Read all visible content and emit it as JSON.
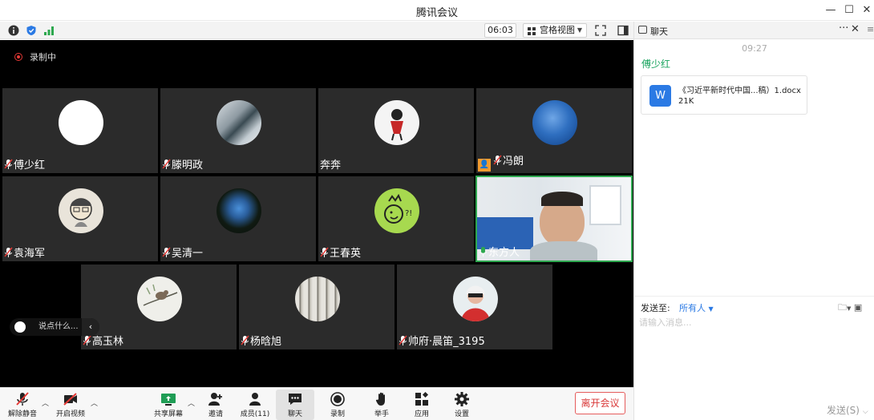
{
  "window": {
    "title": "腾讯会议"
  },
  "topbar": {
    "time": "06:03",
    "view_label": "宫格视图"
  },
  "recording": {
    "label": "录制中"
  },
  "participants": [
    {
      "name": "傅少红",
      "muted": true
    },
    {
      "name": "滕明政",
      "muted": true
    },
    {
      "name": "奔奔",
      "muted": false
    },
    {
      "name": "冯朗",
      "muted": true
    },
    {
      "name": "袁海军",
      "muted": true
    },
    {
      "name": "吴清一",
      "muted": true
    },
    {
      "name": "王春英",
      "muted": true
    },
    {
      "name": "东方人",
      "muted": false
    },
    {
      "name": "高玉林",
      "muted": true
    },
    {
      "name": "杨晗旭",
      "muted": true
    },
    {
      "name": "帅府·晨笛_3195",
      "muted": true
    }
  ],
  "chat_pill": {
    "placeholder": "说点什么..."
  },
  "toolbar": {
    "unmute": "解除静音",
    "start_video": "开启视频",
    "share": "共享屏幕",
    "invite": "邀请",
    "members": "成员(11)",
    "chat": "聊天",
    "record": "录制",
    "raise_hand": "举手",
    "apps": "应用",
    "settings": "设置",
    "leave": "离开会议"
  },
  "chat": {
    "title": "聊天",
    "timestamp": "09:27",
    "sender": "傅少红",
    "file_name": "《习近平新时代中国...稿）1.docx",
    "file_size": "21K",
    "send_to_label": "发送至:",
    "send_to_value": "所有人",
    "input_placeholder": "请输入消息...",
    "send_button": "发送(S)"
  },
  "colors": {
    "accent": "#2b7ae4",
    "leave": "#d93838",
    "active_speaker": "#2ea84f",
    "sender_name": "#1aa45f"
  }
}
